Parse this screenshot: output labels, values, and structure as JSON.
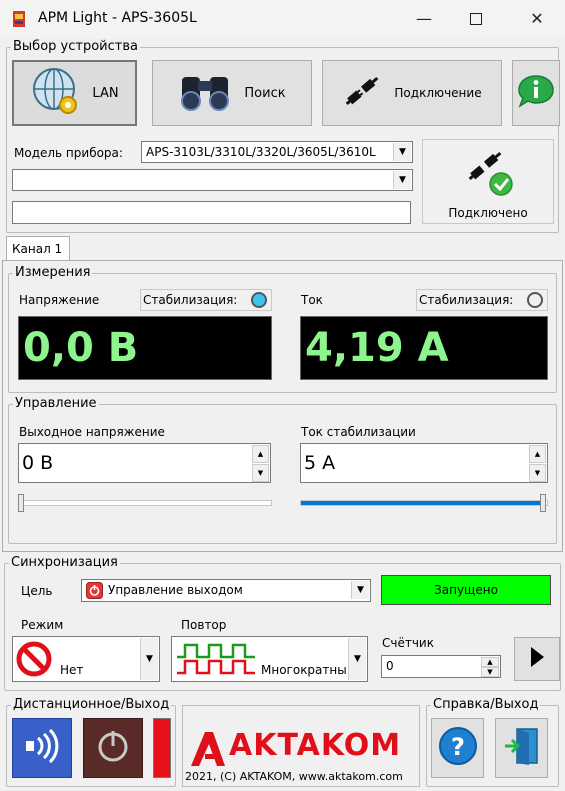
{
  "window": {
    "title": "APM Light - APS-3605L",
    "icon": "app-icon"
  },
  "device": {
    "group_label": "Выбор устройства",
    "lan_button": "LAN",
    "search_button": "Поиск",
    "connect_button": "Подключение",
    "model_label": "Модель прибора:",
    "model_value": "APS-3103L/3310L/3320L/3605L/3610L",
    "address_value": "",
    "serial_value": "",
    "status_label": "Подключено"
  },
  "tabs": [
    {
      "label": "Канал 1"
    }
  ],
  "measure": {
    "group_label": "Измерения",
    "voltage_label": "Напряжение",
    "voltage_stab_label": "Стабилизация:",
    "voltage_value": "0,0 В",
    "current_label": "Ток",
    "current_stab_label": "Стабилизация:",
    "current_value": "4,19 А",
    "voltage_stab_active": true,
    "current_stab_active": false
  },
  "control": {
    "group_label": "Управление",
    "out_voltage_label": "Выходное напряжение",
    "out_voltage_value": "0 В",
    "out_voltage_slider": 0.0,
    "stab_current_label": "Ток стабилизации",
    "stab_current_value": "5 А",
    "stab_current_slider": 1.0
  },
  "sync": {
    "group_label": "Синхронизация",
    "target_label": "Цель",
    "target_value": "Управление выходом",
    "status_value": "Запущено",
    "mode_label": "Режим",
    "mode_value": "Нет",
    "repeat_label": "Повтор",
    "repeat_value": "Многократны",
    "counter_label": "Счётчик",
    "counter_value": "0"
  },
  "footer": {
    "remote_label": "Дистанционное/Выход",
    "brand_text": "AKTAKOM",
    "copyright": "2021, (C) AKTAKOM, www.aktakom.com",
    "help_label": "Справка/Выход"
  },
  "colors": {
    "lcd_text": "#8ef58e",
    "running": "#00ff00",
    "stab_on": "#39c6f0",
    "slider_fill": "#0078d7",
    "red_bar": "#e8111b"
  }
}
